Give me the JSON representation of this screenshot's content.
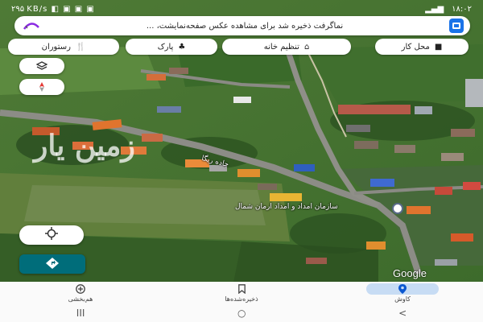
{
  "status_bar": {
    "time": "۱۸:۰۲",
    "left_icons_text": "۲۹۵ KB/s ‪◧‬ ▣ ▣ ▣"
  },
  "search": {
    "toast_text": "نماگرفت ذخیره شد  برای مشاهده عکس صفحه‌نمایشت، ..."
  },
  "chips": [
    {
      "label": "محل کار",
      "icon": "briefcase-icon"
    },
    {
      "label": "تنظیم خانه",
      "icon": "home-icon"
    },
    {
      "label": "پارک",
      "icon": "park-icon"
    },
    {
      "label": "رستوران",
      "icon": "restaurant-icon"
    }
  ],
  "map": {
    "road_label_1": "جاده ریگا",
    "poi_label": "سازمان امداد و امداد ارمان شمال",
    "watermark": "زمین یار",
    "google_logo": "Google"
  },
  "bottom_nav": {
    "items": [
      {
        "label": "کاوش",
        "icon": "location-pin-icon",
        "selected": true
      },
      {
        "label": "ذخیره‌شده‌ها",
        "icon": "bookmark-icon",
        "selected": false
      },
      {
        "label": "هم‌بخشی",
        "icon": "add-circle-icon",
        "selected": false
      }
    ]
  },
  "system_nav": {
    "back": "<",
    "home": "○",
    "recents": "III"
  },
  "colors": {
    "accent": "#1a73e8",
    "selected_pill": "#c7dcf4",
    "directions_button": "#006d7a"
  }
}
